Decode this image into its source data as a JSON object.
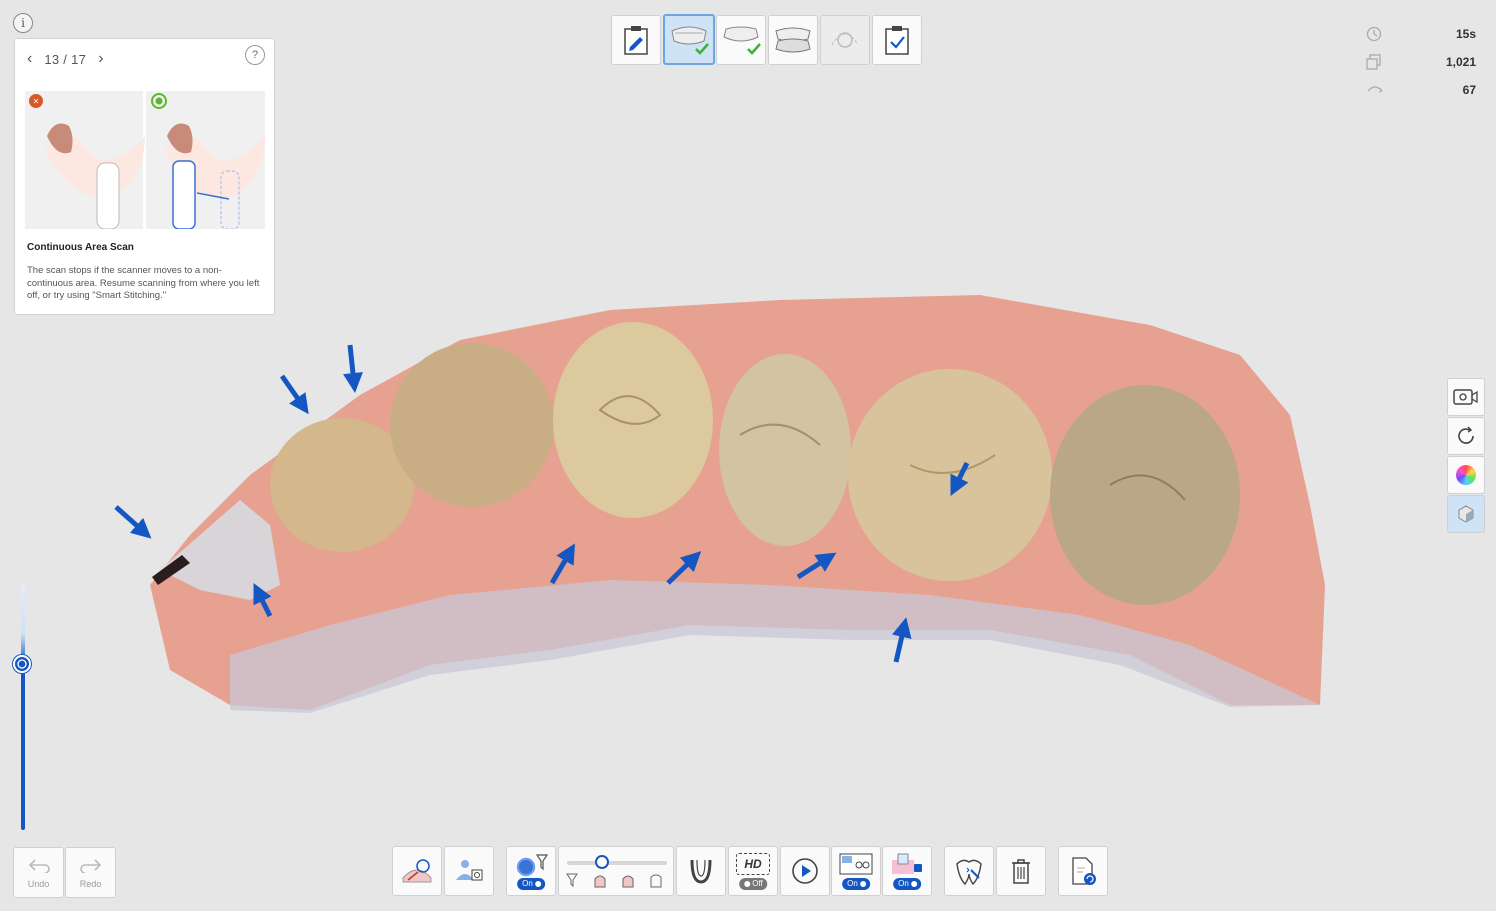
{
  "guide": {
    "page": "13 / 17",
    "help": "?",
    "info": "i",
    "title": "Continuous Area Scan",
    "description": "The scan stops if the scanner moves to a non-continuous area. Resume scanning from where you left off, or try using \"Smart Stitching.\""
  },
  "stats": [
    {
      "icon": "clock-icon",
      "value": "15s"
    },
    {
      "icon": "images-icon",
      "value": "1,021"
    },
    {
      "icon": "rotation-icon",
      "value": "67"
    }
  ],
  "history": {
    "undo": "Undo",
    "redo": "Redo"
  },
  "toolbar": {
    "toggle_on": "On",
    "toggle_off": "Off",
    "hd": "HD"
  },
  "colors": {
    "accent": "#1557c2",
    "active": "#cfe3f7",
    "gum": "#e8998a",
    "tooth": "#d9c9a5"
  }
}
